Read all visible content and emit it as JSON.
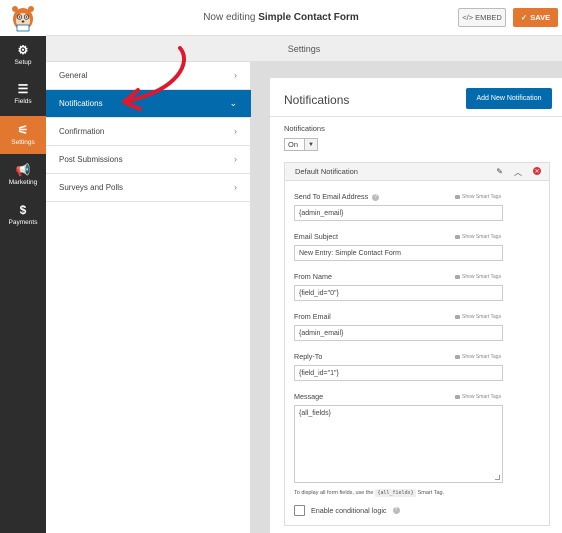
{
  "header": {
    "title_prefix": "Now editing",
    "form_name": "Simple Contact Form",
    "embed_label": "EMBED",
    "save_label": "SAVE"
  },
  "leftbar": {
    "items": [
      {
        "label": "Setup",
        "icon": "gear-icon"
      },
      {
        "label": "Fields",
        "icon": "list-icon"
      },
      {
        "label": "Settings",
        "icon": "sliders-icon"
      },
      {
        "label": "Marketing",
        "icon": "megaphone-icon"
      },
      {
        "label": "Payments",
        "icon": "dollar-icon"
      }
    ],
    "active": "Settings"
  },
  "settings_header": "Settings",
  "submenu": {
    "items": [
      {
        "label": "General"
      },
      {
        "label": "Notifications"
      },
      {
        "label": "Confirmation"
      },
      {
        "label": "Post Submissions"
      },
      {
        "label": "Surveys and Polls"
      }
    ],
    "active": "Notifications"
  },
  "panel": {
    "title": "Notifications",
    "add_button": "Add New Notification",
    "notifications_label": "Notifications",
    "notifications_value": "On"
  },
  "notification": {
    "name": "Default Notification",
    "smart_tags_label": "Show Smart Tags",
    "fields": {
      "send_to": {
        "label": "Send To Email Address",
        "value": "{admin_email}"
      },
      "subject": {
        "label": "Email Subject",
        "value": "New Entry: Simple Contact Form"
      },
      "from_name": {
        "label": "From Name",
        "value": "{field_id=\"0\"}"
      },
      "from_email": {
        "label": "From Email",
        "value": "{admin_email}"
      },
      "reply_to": {
        "label": "Reply-To",
        "value": "{field_id=\"1\"}"
      },
      "message": {
        "label": "Message",
        "value": "{all_fields}"
      }
    },
    "hint_before": "To display all form fields, use the",
    "hint_code": "{all_fields}",
    "hint_after": "Smart Tag.",
    "conditional_logic_label": "Enable conditional logic",
    "conditional_logic_checked": false
  },
  "colors": {
    "accent_orange": "#e27730",
    "active_blue": "#036aab",
    "sidebar_dark": "#2d2d2d",
    "arrow_red": "#e0182d"
  }
}
